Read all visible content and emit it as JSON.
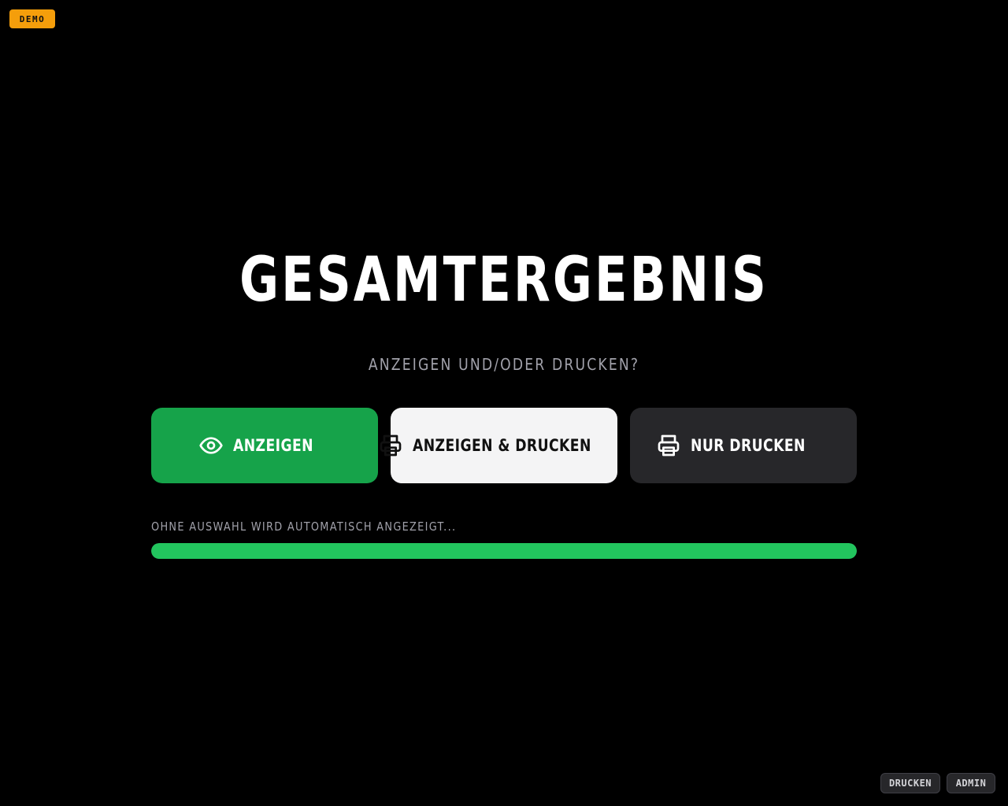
{
  "badge": {
    "label": "DEMO",
    "color": "#f59e0b"
  },
  "heading": {
    "title": "GESAMTERGEBNIS",
    "subtitle": "ANZEIGEN UND/ODER DRUCKEN?"
  },
  "actions": {
    "show": {
      "label": "ANZEIGEN",
      "icon": "eye-icon",
      "color": "#16a34a"
    },
    "show_print": {
      "label": "ANZEIGEN & DRUCKEN",
      "icon": "printer-icon",
      "color": "#f4f4f5"
    },
    "print_only": {
      "label": "NUR DRUCKEN",
      "icon": "printer-icon",
      "color": "#27272a"
    }
  },
  "countdown": {
    "hint": "OHNE AUSWAHL WIRD AUTOMATISCH ANGEZEIGT...",
    "progress": 1.0,
    "color": "#22c55e"
  },
  "footer": {
    "print_label": "DRUCKEN",
    "admin_label": "ADMIN"
  }
}
